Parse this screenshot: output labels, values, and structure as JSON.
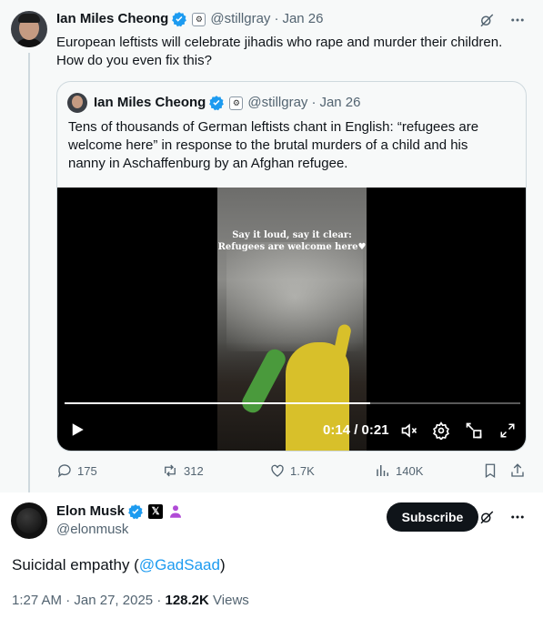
{
  "parent_tweet": {
    "author_name": "Ian Miles Cheong",
    "handle": "@stillgray",
    "date": "Jan 26",
    "text_line1": "European leftists will celebrate jihadis who rape and murder their children.",
    "text_line2": "How do you even fix this?",
    "quote": {
      "author_name": "Ian Miles Cheong",
      "handle": "@stillgray",
      "date": "Jan 26",
      "text_line1": "Tens of thousands of German leftists chant in English: “refugees are",
      "text_line2": "welcome here” in response to the brutal murders of a child and his",
      "text_line3": "nanny in Aschaffenburg by an Afghan refugee.",
      "video": {
        "caption_line1": "Say it loud, say it clear:",
        "caption_line2": "Refugees are welcome here♥",
        "current_time": "0:14",
        "duration": "0:21",
        "time_display": "0:14 / 0:21",
        "progress_fraction": 0.67
      }
    },
    "stats": {
      "replies": "175",
      "reposts": "312",
      "likes": "1.7K",
      "views": "140K"
    }
  },
  "main_tweet": {
    "author_name": "Elon Musk",
    "handle": "@elonmusk",
    "subscribe_label": "Subscribe",
    "text_before": "Suicidal empathy (",
    "mention": "@GadSaad",
    "text_after": ")",
    "time": "1:27 AM",
    "date": "Jan 27, 2025",
    "views_count": "128.2K",
    "views_label": "Views"
  },
  "icons": {
    "verified_color": "#1d9bf0",
    "grok": "grok-icon",
    "more": "more-icon",
    "reply": "reply-icon",
    "repost": "repost-icon",
    "like": "like-icon",
    "views": "views-icon",
    "bookmark": "bookmark-icon",
    "share": "share-icon",
    "play": "play-icon",
    "mute": "mute-icon",
    "settings": "settings-icon",
    "pip": "pip-icon",
    "fullscreen": "fullscreen-icon"
  }
}
